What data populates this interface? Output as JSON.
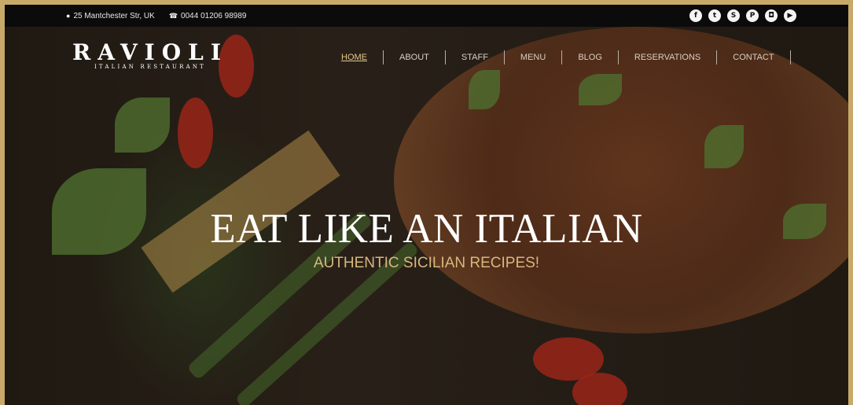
{
  "topbar": {
    "address": "25 Mantchester Str, UK",
    "phone": "0044 01206 98989",
    "address_icon": "map-marker-icon",
    "phone_icon": "phone-icon",
    "socials": [
      {
        "name": "facebook-icon",
        "glyph": "f"
      },
      {
        "name": "twitter-icon",
        "glyph": "t"
      },
      {
        "name": "skype-icon",
        "glyph": "S"
      },
      {
        "name": "pinterest-icon",
        "glyph": "P"
      },
      {
        "name": "instagram-icon",
        "glyph": "◘"
      },
      {
        "name": "youtube-icon",
        "glyph": "▶"
      }
    ]
  },
  "logo": {
    "name": "RAVIOLI",
    "tagline": "ITALIAN RESTAURANT"
  },
  "nav": {
    "items": [
      {
        "label": "HOME",
        "active": true
      },
      {
        "label": "ABOUT",
        "active": false
      },
      {
        "label": "STAFF",
        "active": false
      },
      {
        "label": "MENU",
        "active": false
      },
      {
        "label": "BLOG",
        "active": false
      },
      {
        "label": "RESERVATIONS",
        "active": false
      },
      {
        "label": "CONTACT",
        "active": false
      }
    ]
  },
  "hero": {
    "headline": "EAT LIKE AN ITALIAN",
    "subheadline": "AUTHENTIC SICILIAN RECIPES!"
  },
  "colors": {
    "frame": "#c8a96a",
    "topbar": "#0b0b0b",
    "accent": "#e3c78a",
    "subheadline": "#d9b67c"
  }
}
